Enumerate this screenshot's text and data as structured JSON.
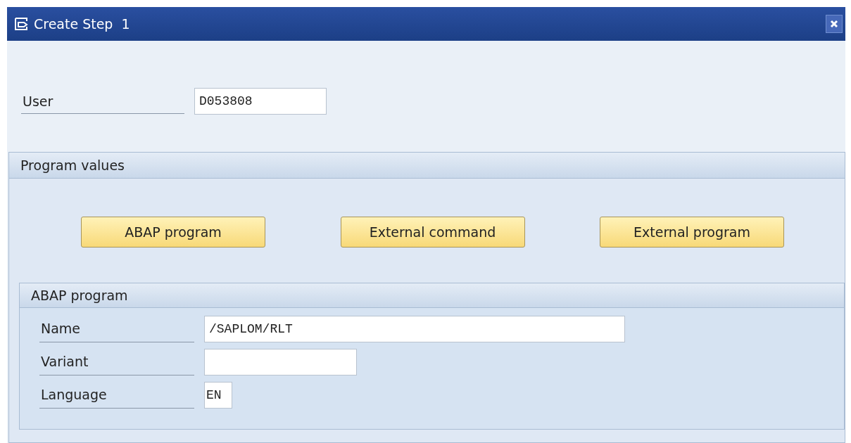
{
  "window": {
    "title": "Create Step  1"
  },
  "user_field": {
    "label": "User",
    "value": "D053808"
  },
  "program_values": {
    "title": "Program values",
    "buttons": [
      "ABAP program",
      "External command",
      "External program"
    ],
    "abap_program": {
      "title": "ABAP program",
      "fields": [
        {
          "label": "Name",
          "value": "/SAPLOM/RLT"
        },
        {
          "label": "Variant"
        },
        {
          "label": "Language",
          "value": "EN"
        }
      ]
    }
  }
}
